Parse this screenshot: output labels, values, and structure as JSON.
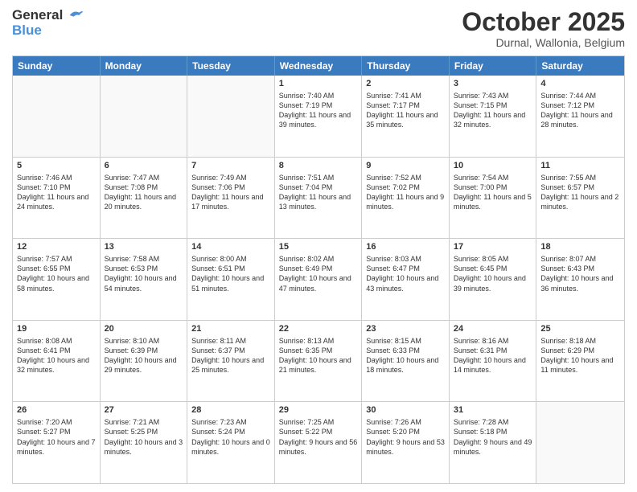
{
  "header": {
    "logo_line1": "General",
    "logo_line2": "Blue",
    "month": "October 2025",
    "location": "Durnal, Wallonia, Belgium"
  },
  "weekdays": [
    "Sunday",
    "Monday",
    "Tuesday",
    "Wednesday",
    "Thursday",
    "Friday",
    "Saturday"
  ],
  "weeks": [
    [
      {
        "day": "",
        "sunrise": "",
        "sunset": "",
        "daylight": ""
      },
      {
        "day": "",
        "sunrise": "",
        "sunset": "",
        "daylight": ""
      },
      {
        "day": "",
        "sunrise": "",
        "sunset": "",
        "daylight": ""
      },
      {
        "day": "1",
        "sunrise": "Sunrise: 7:40 AM",
        "sunset": "Sunset: 7:19 PM",
        "daylight": "Daylight: 11 hours and 39 minutes."
      },
      {
        "day": "2",
        "sunrise": "Sunrise: 7:41 AM",
        "sunset": "Sunset: 7:17 PM",
        "daylight": "Daylight: 11 hours and 35 minutes."
      },
      {
        "day": "3",
        "sunrise": "Sunrise: 7:43 AM",
        "sunset": "Sunset: 7:15 PM",
        "daylight": "Daylight: 11 hours and 32 minutes."
      },
      {
        "day": "4",
        "sunrise": "Sunrise: 7:44 AM",
        "sunset": "Sunset: 7:12 PM",
        "daylight": "Daylight: 11 hours and 28 minutes."
      }
    ],
    [
      {
        "day": "5",
        "sunrise": "Sunrise: 7:46 AM",
        "sunset": "Sunset: 7:10 PM",
        "daylight": "Daylight: 11 hours and 24 minutes."
      },
      {
        "day": "6",
        "sunrise": "Sunrise: 7:47 AM",
        "sunset": "Sunset: 7:08 PM",
        "daylight": "Daylight: 11 hours and 20 minutes."
      },
      {
        "day": "7",
        "sunrise": "Sunrise: 7:49 AM",
        "sunset": "Sunset: 7:06 PM",
        "daylight": "Daylight: 11 hours and 17 minutes."
      },
      {
        "day": "8",
        "sunrise": "Sunrise: 7:51 AM",
        "sunset": "Sunset: 7:04 PM",
        "daylight": "Daylight: 11 hours and 13 minutes."
      },
      {
        "day": "9",
        "sunrise": "Sunrise: 7:52 AM",
        "sunset": "Sunset: 7:02 PM",
        "daylight": "Daylight: 11 hours and 9 minutes."
      },
      {
        "day": "10",
        "sunrise": "Sunrise: 7:54 AM",
        "sunset": "Sunset: 7:00 PM",
        "daylight": "Daylight: 11 hours and 5 minutes."
      },
      {
        "day": "11",
        "sunrise": "Sunrise: 7:55 AM",
        "sunset": "Sunset: 6:57 PM",
        "daylight": "Daylight: 11 hours and 2 minutes."
      }
    ],
    [
      {
        "day": "12",
        "sunrise": "Sunrise: 7:57 AM",
        "sunset": "Sunset: 6:55 PM",
        "daylight": "Daylight: 10 hours and 58 minutes."
      },
      {
        "day": "13",
        "sunrise": "Sunrise: 7:58 AM",
        "sunset": "Sunset: 6:53 PM",
        "daylight": "Daylight: 10 hours and 54 minutes."
      },
      {
        "day": "14",
        "sunrise": "Sunrise: 8:00 AM",
        "sunset": "Sunset: 6:51 PM",
        "daylight": "Daylight: 10 hours and 51 minutes."
      },
      {
        "day": "15",
        "sunrise": "Sunrise: 8:02 AM",
        "sunset": "Sunset: 6:49 PM",
        "daylight": "Daylight: 10 hours and 47 minutes."
      },
      {
        "day": "16",
        "sunrise": "Sunrise: 8:03 AM",
        "sunset": "Sunset: 6:47 PM",
        "daylight": "Daylight: 10 hours and 43 minutes."
      },
      {
        "day": "17",
        "sunrise": "Sunrise: 8:05 AM",
        "sunset": "Sunset: 6:45 PM",
        "daylight": "Daylight: 10 hours and 39 minutes."
      },
      {
        "day": "18",
        "sunrise": "Sunrise: 8:07 AM",
        "sunset": "Sunset: 6:43 PM",
        "daylight": "Daylight: 10 hours and 36 minutes."
      }
    ],
    [
      {
        "day": "19",
        "sunrise": "Sunrise: 8:08 AM",
        "sunset": "Sunset: 6:41 PM",
        "daylight": "Daylight: 10 hours and 32 minutes."
      },
      {
        "day": "20",
        "sunrise": "Sunrise: 8:10 AM",
        "sunset": "Sunset: 6:39 PM",
        "daylight": "Daylight: 10 hours and 29 minutes."
      },
      {
        "day": "21",
        "sunrise": "Sunrise: 8:11 AM",
        "sunset": "Sunset: 6:37 PM",
        "daylight": "Daylight: 10 hours and 25 minutes."
      },
      {
        "day": "22",
        "sunrise": "Sunrise: 8:13 AM",
        "sunset": "Sunset: 6:35 PM",
        "daylight": "Daylight: 10 hours and 21 minutes."
      },
      {
        "day": "23",
        "sunrise": "Sunrise: 8:15 AM",
        "sunset": "Sunset: 6:33 PM",
        "daylight": "Daylight: 10 hours and 18 minutes."
      },
      {
        "day": "24",
        "sunrise": "Sunrise: 8:16 AM",
        "sunset": "Sunset: 6:31 PM",
        "daylight": "Daylight: 10 hours and 14 minutes."
      },
      {
        "day": "25",
        "sunrise": "Sunrise: 8:18 AM",
        "sunset": "Sunset: 6:29 PM",
        "daylight": "Daylight: 10 hours and 11 minutes."
      }
    ],
    [
      {
        "day": "26",
        "sunrise": "Sunrise: 7:20 AM",
        "sunset": "Sunset: 5:27 PM",
        "daylight": "Daylight: 10 hours and 7 minutes."
      },
      {
        "day": "27",
        "sunrise": "Sunrise: 7:21 AM",
        "sunset": "Sunset: 5:25 PM",
        "daylight": "Daylight: 10 hours and 3 minutes."
      },
      {
        "day": "28",
        "sunrise": "Sunrise: 7:23 AM",
        "sunset": "Sunset: 5:24 PM",
        "daylight": "Daylight: 10 hours and 0 minutes."
      },
      {
        "day": "29",
        "sunrise": "Sunrise: 7:25 AM",
        "sunset": "Sunset: 5:22 PM",
        "daylight": "Daylight: 9 hours and 56 minutes."
      },
      {
        "day": "30",
        "sunrise": "Sunrise: 7:26 AM",
        "sunset": "Sunset: 5:20 PM",
        "daylight": "Daylight: 9 hours and 53 minutes."
      },
      {
        "day": "31",
        "sunrise": "Sunrise: 7:28 AM",
        "sunset": "Sunset: 5:18 PM",
        "daylight": "Daylight: 9 hours and 49 minutes."
      },
      {
        "day": "",
        "sunrise": "",
        "sunset": "",
        "daylight": ""
      }
    ]
  ]
}
